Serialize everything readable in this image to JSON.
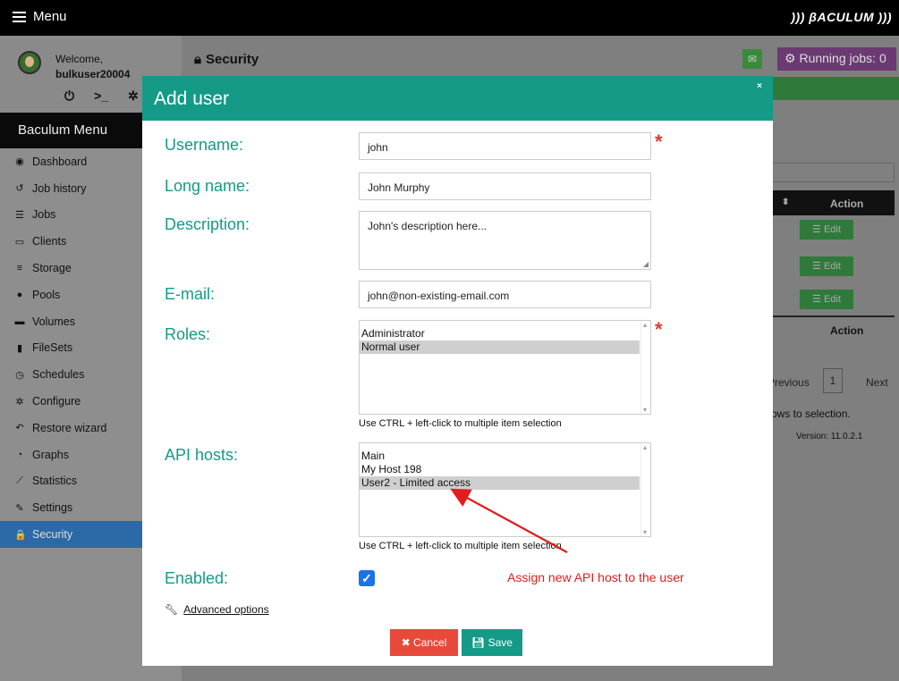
{
  "topbar": {
    "menu_label": "Menu",
    "brand": "))) βACULUM )))"
  },
  "sidebar": {
    "welcome": "Welcome,",
    "username": "bulkuser20004",
    "menu_title": "Baculum Menu",
    "items": [
      {
        "label": "Dashboard",
        "icon": "tachometer-icon",
        "glyph": "◉"
      },
      {
        "label": "Job history",
        "icon": "history-icon",
        "glyph": "↺"
      },
      {
        "label": "Jobs",
        "icon": "list-icon",
        "glyph": "☰"
      },
      {
        "label": "Clients",
        "icon": "desktop-icon",
        "glyph": "▭"
      },
      {
        "label": "Storage",
        "icon": "database-icon",
        "glyph": "≡"
      },
      {
        "label": "Pools",
        "icon": "search-icon",
        "glyph": "●"
      },
      {
        "label": "Volumes",
        "icon": "hdd-icon",
        "glyph": "▬"
      },
      {
        "label": "FileSets",
        "icon": "copy-icon",
        "glyph": "▮"
      },
      {
        "label": "Schedules",
        "icon": "clock-icon",
        "glyph": "◷"
      },
      {
        "label": "Configure",
        "icon": "gear-icon",
        "glyph": "✲"
      },
      {
        "label": "Restore wizard",
        "icon": "reply-icon",
        "glyph": "↶"
      },
      {
        "label": "Graphs",
        "icon": "pie-chart-icon",
        "glyph": "◔"
      },
      {
        "label": "Statistics",
        "icon": "line-chart-icon",
        "glyph": "⟋"
      },
      {
        "label": "Settings",
        "icon": "wrench-icon",
        "glyph": "✎"
      },
      {
        "label": "Security",
        "icon": "lock-icon",
        "glyph": "🔒"
      }
    ]
  },
  "page": {
    "title": "Security",
    "running_jobs": "Running jobs: 0",
    "table_action": "Action",
    "edit_label": "Edit",
    "pager_prev": "Previous",
    "pager_page": "1",
    "pager_next": "Next",
    "rows_selection": "rows to selection.",
    "version": "Version: 11.0.2.1"
  },
  "modal": {
    "title": "Add user",
    "close": "×",
    "username_label": "Username:",
    "username_value": "john",
    "longname_label": "Long name:",
    "longname_value": "John Murphy",
    "description_label": "Description:",
    "description_value": "John's description here...",
    "email_label": "E-mail:",
    "email_value": "john@non-existing-email.com",
    "roles_label": "Roles:",
    "roles_options": [
      "Administrator",
      "Normal user"
    ],
    "roles_hint": "Use CTRL + left-click to multiple item selection",
    "api_hosts_label": "API hosts:",
    "api_hosts_options": [
      "Main",
      "My Host 198",
      "User2 - Limited access"
    ],
    "api_hosts_hint": "Use CTRL + left-click to multiple item selection",
    "enabled_label": "Enabled:",
    "annotation": "Assign new API host to the user",
    "advanced_label": "Advanced options",
    "cancel_label": "Cancel",
    "save_label": "Save"
  }
}
